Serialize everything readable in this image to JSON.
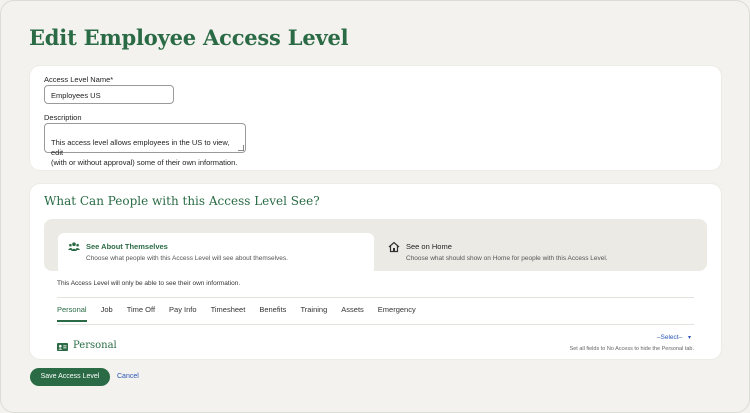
{
  "page": {
    "title": "Edit Employee Access Level"
  },
  "form": {
    "name_label": "Access Level Name*",
    "name_value": "Employees US",
    "description_label": "Description",
    "description_value": "This access level allows employees in the US to view, edit\n(with or without approval) some of their own information."
  },
  "visibility": {
    "title": "What Can People with this Access Level See?",
    "options": [
      {
        "label": "See About Themselves",
        "description": "Choose what people with this Access Level will see about themselves.",
        "icon": "people-icon",
        "selected": true
      },
      {
        "label": "See on Home",
        "description": "Choose what should show on Home for people with this Access Level.",
        "icon": "home-icon",
        "selected": false
      }
    ],
    "note": "This Access Level will only be able to see their own information."
  },
  "tabs": [
    {
      "label": "Personal",
      "active": true
    },
    {
      "label": "Job"
    },
    {
      "label": "Time Off"
    },
    {
      "label": "Pay Info"
    },
    {
      "label": "Timesheet"
    },
    {
      "label": "Benefits"
    },
    {
      "label": "Training"
    },
    {
      "label": "Assets"
    },
    {
      "label": "Emergency"
    }
  ],
  "personal_section": {
    "title": "Personal",
    "icon": "id-card-icon",
    "select_label": "–Select–",
    "select_hint": "Set all fields to No Access to hide the Personal tab."
  },
  "footer": {
    "save_label": "Save Access Level",
    "cancel_label": "Cancel"
  },
  "colors": {
    "brand_green": "#2a6b45",
    "link_blue": "#2a55b5",
    "background": "#f3f2ee"
  }
}
